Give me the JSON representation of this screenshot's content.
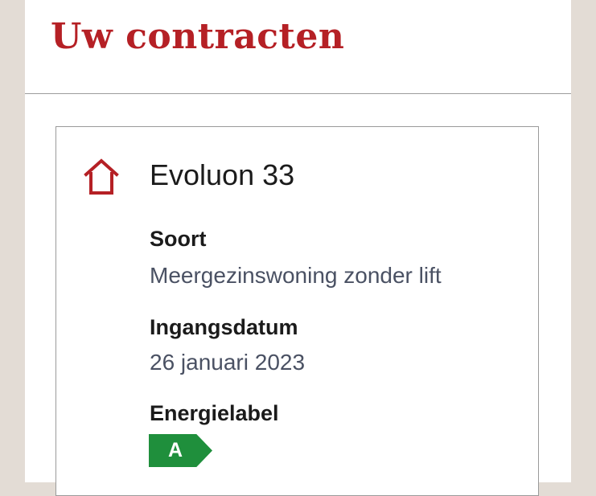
{
  "page": {
    "title": "Uw contracten"
  },
  "contract": {
    "icon": "house-icon",
    "address": "Evoluon 33",
    "soort_label": "Soort",
    "soort_value": "Meergezinswoning zonder lift",
    "ingangsdatum_label": "Ingangsdatum",
    "ingangsdatum_value": "26 januari 2023",
    "energielabel_label": "Energielabel",
    "energielabel_value": "A",
    "energielabel_color": "#1f8f3c"
  },
  "colors": {
    "accent": "#b52025",
    "background": "#e3dcd5",
    "value_text": "#4a5163"
  }
}
